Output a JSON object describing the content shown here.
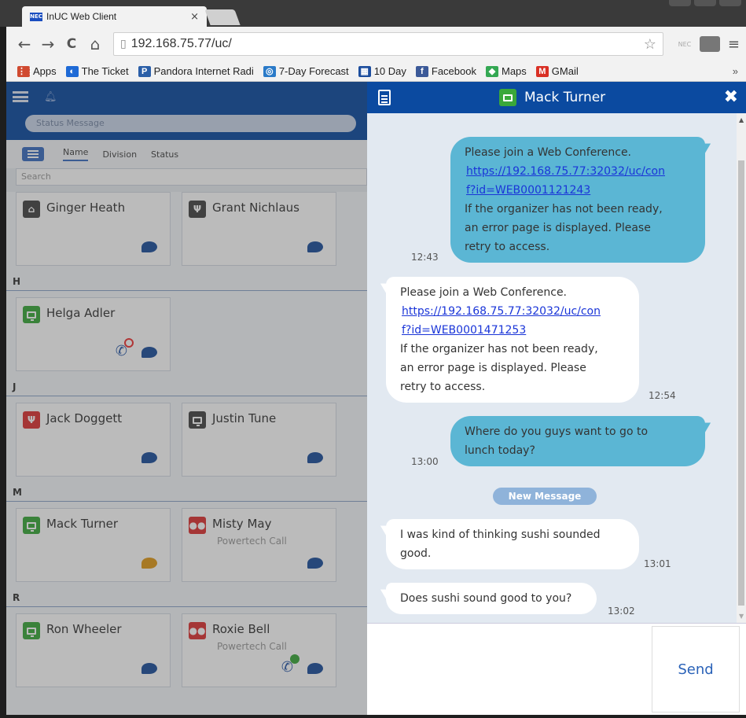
{
  "browser": {
    "tab_title": "InUC Web Client",
    "tab_close": "×",
    "favicon_text": "NEC",
    "url": "192.168.75.77/uc/",
    "back": "←",
    "forward": "→",
    "reload": "C",
    "home": "⌂",
    "star": "☆",
    "menu": "≡",
    "ext_label": "NEC",
    "bookmarks": [
      {
        "label": "Apps",
        "icon": "apps-icon",
        "icon_text": "⋮⋮",
        "color": "#d04a30"
      },
      {
        "label": "The Ticket",
        "icon": "ticket-icon",
        "icon_text": "◐",
        "color": "#1e6ad6"
      },
      {
        "label": "Pandora Internet Radi",
        "icon": "pandora-icon",
        "icon_text": "P",
        "color": "#2b5fa8"
      },
      {
        "label": "7-Day Forecast",
        "icon": "forecast-icon",
        "icon_text": "◎",
        "color": "#2a7ac8"
      },
      {
        "label": "10 Day",
        "icon": "weather-icon",
        "icon_text": "▦",
        "color": "#1d4e9e"
      },
      {
        "label": "Facebook",
        "icon": "facebook-icon",
        "icon_text": "f",
        "color": "#3b5998"
      },
      {
        "label": "Maps",
        "icon": "maps-icon",
        "icon_text": "◆",
        "color": "#34a853"
      },
      {
        "label": "GMail",
        "icon": "gmail-icon",
        "icon_text": "M",
        "color": "#d93025"
      }
    ],
    "bookmarks_more": "»"
  },
  "contacts_panel": {
    "status_placeholder": "Status Message",
    "sort_tabs": [
      "Name",
      "Division",
      "Status"
    ],
    "search_placeholder": "Search",
    "sections": [
      {
        "letter": "",
        "cards": [
          {
            "name": "Ginger Heath",
            "sub": "",
            "presence": "dark",
            "glyph": "⌂"
          },
          {
            "name": "Grant Nichlaus",
            "sub": "",
            "presence": "dark",
            "glyph": "Ψ"
          }
        ]
      },
      {
        "letter": "H",
        "cards": [
          {
            "name": "Helga Adler",
            "sub": "",
            "presence": "green",
            "glyph": ""
          }
        ]
      },
      {
        "letter": "J",
        "cards": [
          {
            "name": "Jack Doggett",
            "sub": "",
            "presence": "red",
            "glyph": "Ψ"
          },
          {
            "name": "Justin Tune",
            "sub": "",
            "presence": "dark",
            "glyph": ""
          }
        ]
      },
      {
        "letter": "M",
        "cards": [
          {
            "name": "Mack Turner",
            "sub": "",
            "presence": "green",
            "glyph": ""
          },
          {
            "name": "Misty May",
            "sub": "Powertech Call",
            "presence": "red",
            "glyph": "●●"
          }
        ]
      },
      {
        "letter": "R",
        "cards": [
          {
            "name": "Ron Wheeler",
            "sub": "",
            "presence": "green",
            "glyph": ""
          },
          {
            "name": "Roxie Bell",
            "sub": "Powertech Call",
            "presence": "red",
            "glyph": "●●"
          }
        ]
      }
    ]
  },
  "chat": {
    "title": "Mack Turner",
    "close": "✖",
    "new_message_label": "New Message",
    "send_label": "Send",
    "messages": [
      {
        "dir": "out",
        "lines": [
          "Please join a Web Conference."
        ],
        "link": [
          "https://192.168.75.77:32032/uc/con",
          "f?id=WEB0001121243"
        ],
        "after": [
          "If the organizer has not been ready,",
          "an error page is displayed. Please",
          "retry to access."
        ],
        "time": "12:43"
      },
      {
        "dir": "in",
        "lines": [
          "Please join a Web Conference."
        ],
        "link": [
          "https://192.168.75.77:32032/uc/con",
          "f?id=WEB0001471253"
        ],
        "after": [
          "If the organizer has not been ready,",
          "an error page is displayed. Please",
          "retry to access."
        ],
        "time": "12:54"
      },
      {
        "dir": "out",
        "lines": [
          "Where do you guys want to go to",
          "lunch today?"
        ],
        "link": [],
        "after": [],
        "time": "13:00"
      },
      {
        "dir": "in",
        "lines": [
          "I was kind of thinking sushi sounded",
          "good."
        ],
        "link": [],
        "after": [],
        "time": "13:01"
      },
      {
        "dir": "in",
        "lines": [
          "Does sushi sound good to you?"
        ],
        "link": [],
        "after": [],
        "time": "13:02"
      }
    ]
  },
  "colors": {
    "header_blue": "#0b4aa0",
    "bubble_out": "#5bb6d4",
    "bubble_in": "#ffffff",
    "presence_available": "#3aa83a",
    "presence_busy": "#d33333"
  }
}
